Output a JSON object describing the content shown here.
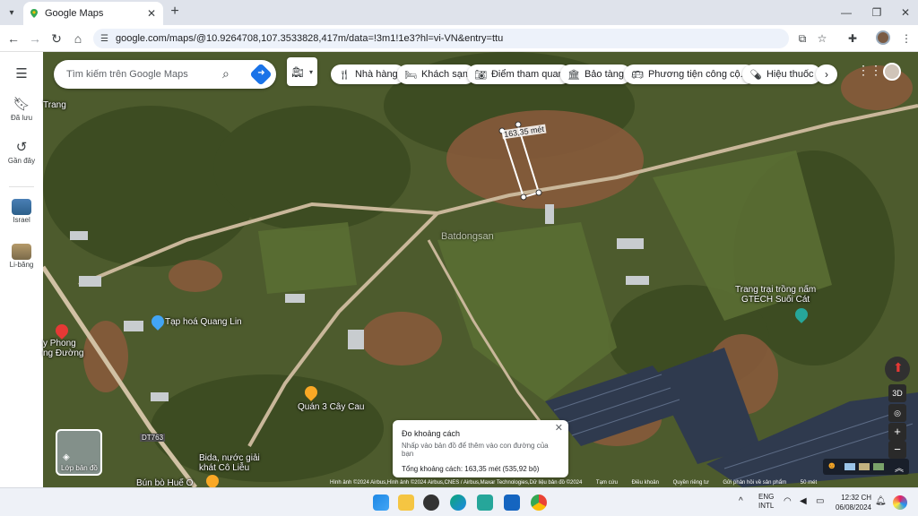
{
  "browser": {
    "tab_title": "Google Maps",
    "url": "google.com/maps/@10.9264708,107.3533828,417m/data=!3m1!1e3?hl=vi-VN&entry=ttu"
  },
  "rail": {
    "saved": "Đã lưu",
    "recent": "Gần đây",
    "place1": "Israel",
    "place2": "Li-băng"
  },
  "search": {
    "placeholder": "Tìm kiếm trên Google Maps"
  },
  "chips": [
    "Nhà hàng",
    "Khách sạn",
    "Điểm tham quan",
    "Bảo tàng",
    "Phương tiện công cộ...",
    "Hiệu thuốc"
  ],
  "map_labels": {
    "trang": "Trang",
    "measure": "163,35 mét",
    "watermark": "Batdongsan",
    "farm": "Trang trại trồng nấm\nGTECH Suối Cát",
    "shop": "Tạp hoá Quang Lin",
    "quan": "Quán 3 Cây Cau",
    "phong": "y Phong\nng Đường",
    "road": "DT763",
    "bida": "Bida, nước giải\nkhát Cô Liễu",
    "bun": "Bún bò Huế O"
  },
  "distance_card": {
    "title": "Đo khoảng cách",
    "hint": "Nhấp vào bản đồ để thêm vào con đường của bạn",
    "total": "Tổng khoảng cách: 163,35 mét (535,92 bộ)"
  },
  "layers_label": "Lớp bản đồ",
  "controls": {
    "three_d": "3D"
  },
  "attribution": [
    "Hình ảnh ©2024 Airbus,Hình ảnh ©2024 Airbus,CNES / Airbus,Maxar Technologies,Dữ liệu bản đồ ©2024",
    "Tạm cứu",
    "Điều khoản",
    "Quyền riêng tư",
    "Gửi phản hồi về sản phẩm",
    "50 mét"
  ],
  "taskbar": {
    "lang1": "ENG",
    "lang2": "INTL",
    "time": "12:32 CH",
    "date": "06/08/2024"
  },
  "colors": {
    "accent": "#1a73e8",
    "map_base": "#4c5a2c"
  }
}
